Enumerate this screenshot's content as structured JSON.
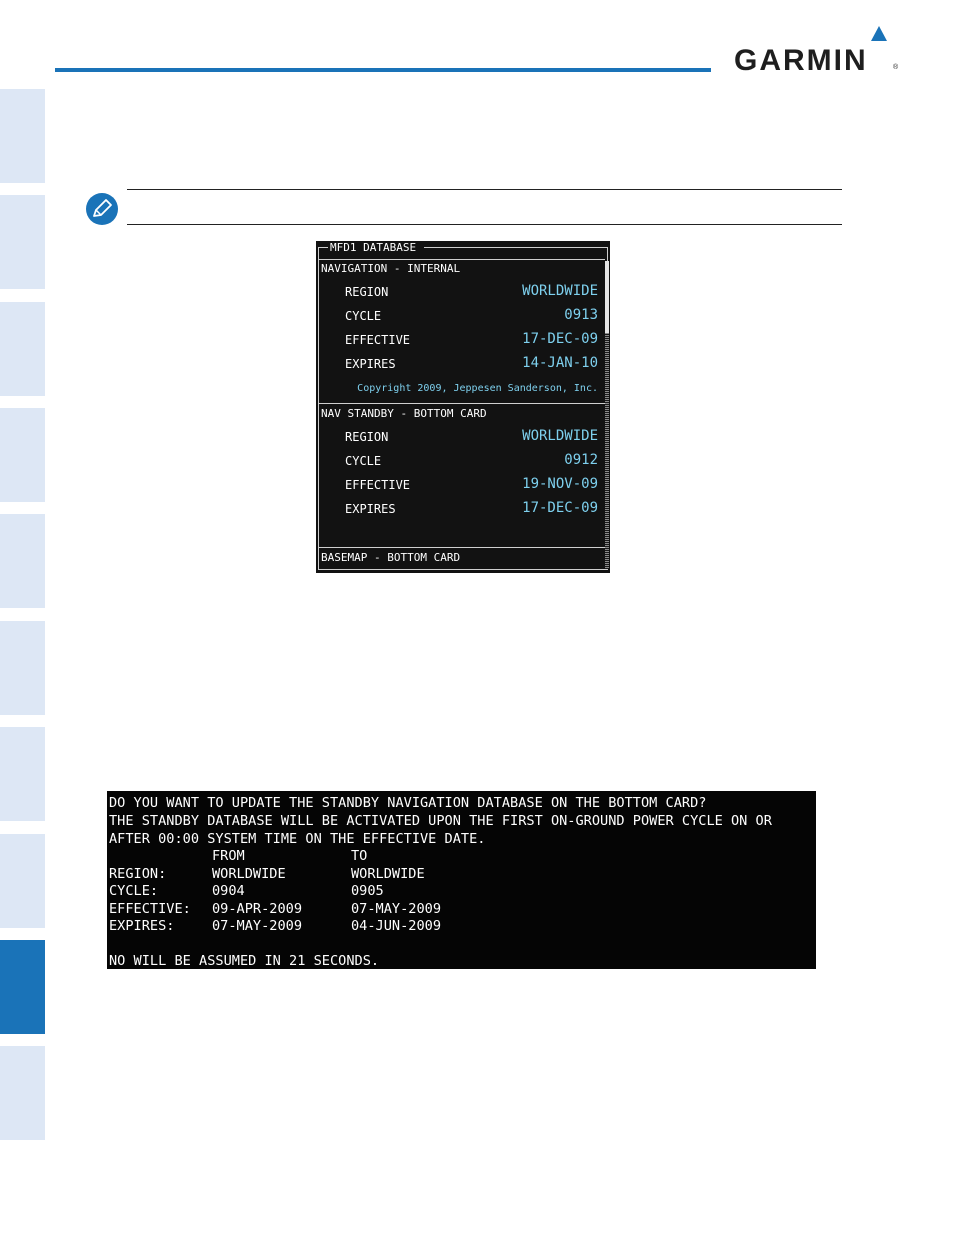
{
  "brand": {
    "logo_text": "GARMIN",
    "registered": "®",
    "accent_color": "#1a73b8"
  },
  "side_tabs": {
    "count": 10,
    "active_index": 8
  },
  "mfd_screen": {
    "title": "MFD1 DATABASE",
    "navigation": {
      "header": "NAVIGATION - INTERNAL",
      "rows": [
        {
          "label": "REGION",
          "value": "WORLDWIDE"
        },
        {
          "label": "CYCLE",
          "value": "0913"
        },
        {
          "label": "EFFECTIVE",
          "value": "17-DEC-09"
        },
        {
          "label": "EXPIRES",
          "value": "14-JAN-10"
        }
      ],
      "copyright": "Copyright 2009, Jeppesen Sanderson, Inc."
    },
    "standby": {
      "header": "NAV STANDBY - BOTTOM CARD",
      "rows": [
        {
          "label": "REGION",
          "value": "WORLDWIDE"
        },
        {
          "label": "CYCLE",
          "value": "0912"
        },
        {
          "label": "EFFECTIVE",
          "value": "19-NOV-09"
        },
        {
          "label": "EXPIRES",
          "value": "17-DEC-09"
        }
      ]
    },
    "basemap": {
      "header": "BASEMAP - BOTTOM CARD"
    },
    "value_color": "#7ed0ee"
  },
  "confirm_screen": {
    "lines": [
      "DO YOU WANT TO UPDATE THE STANDBY NAVIGATION DATABASE ON THE BOTTOM CARD?",
      "THE STANDBY DATABASE WILL BE ACTIVATED UPON THE FIRST ON-GROUND POWER CYCLE ON OR",
      "AFTER 00:00 SYSTEM TIME ON THE EFFECTIVE DATE."
    ],
    "col_from": "FROM",
    "col_to": "TO",
    "rows": [
      {
        "label": "REGION:",
        "from": "WORLDWIDE",
        "to": "WORLDWIDE"
      },
      {
        "label": "CYCLE:",
        "from": "0904",
        "to": "0905"
      },
      {
        "label": "EFFECTIVE:",
        "from": "09-APR-2009",
        "to": "07-MAY-2009"
      },
      {
        "label": "EXPIRES:",
        "from": "07-MAY-2009",
        "to": "04-JUN-2009"
      }
    ],
    "footer": "NO WILL BE ASSUMED IN 21 SECONDS."
  }
}
